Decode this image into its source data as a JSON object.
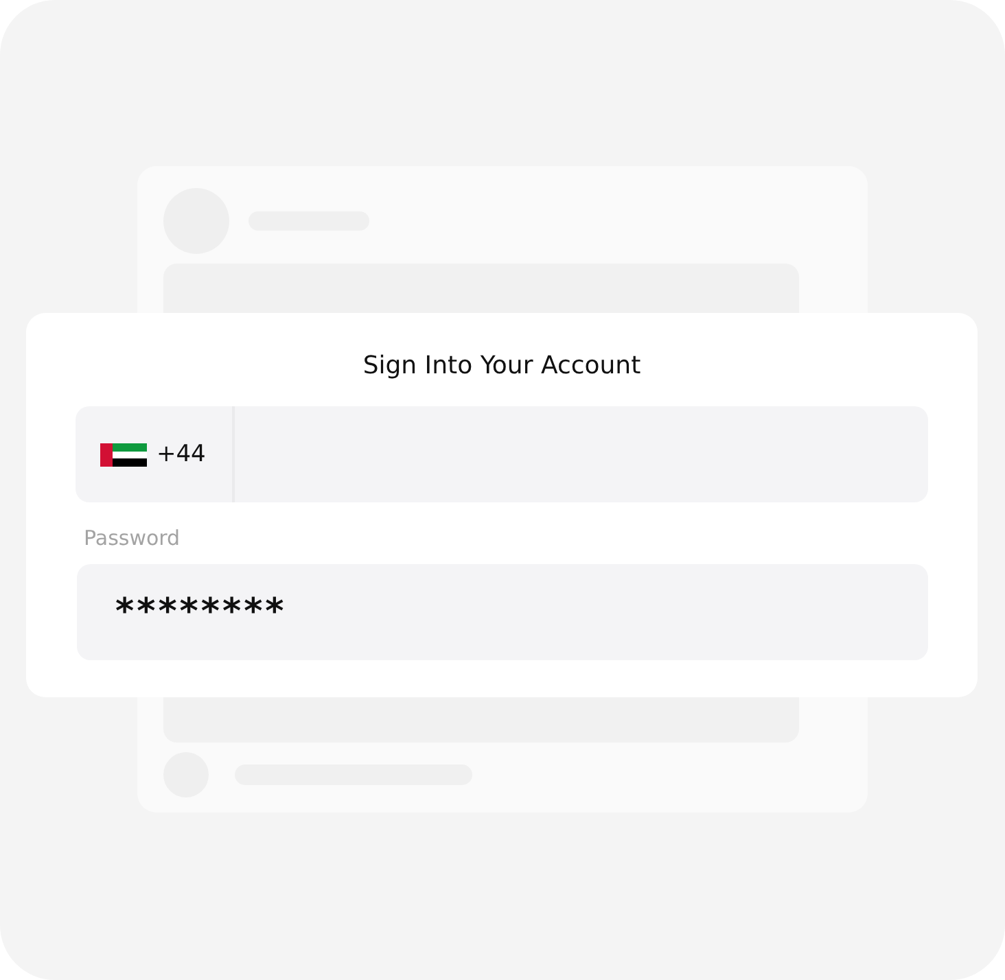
{
  "dialog": {
    "title": "Sign Into Your Account"
  },
  "phone": {
    "country_code": "+44"
  },
  "password": {
    "label": "Password",
    "value": "********"
  }
}
